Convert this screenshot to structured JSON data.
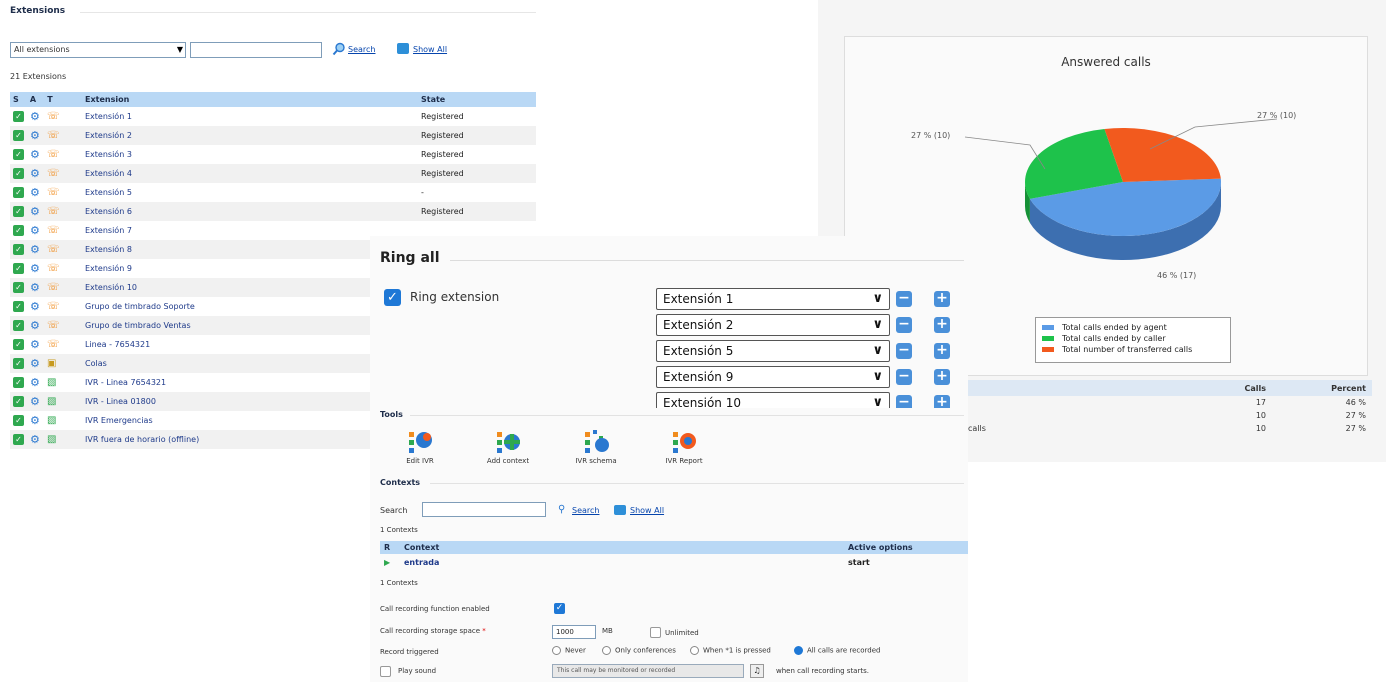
{
  "extensions": {
    "section_title": "Extensions",
    "filter_value": "All extensions",
    "search_label": "Search",
    "show_all_label": "Show All",
    "count_text": "21 Extensions",
    "headers": {
      "s": "S",
      "a": "A",
      "t": "T",
      "extension": "Extension",
      "state": "State"
    },
    "rows": [
      {
        "name": "Extensión 1",
        "state": "Registered",
        "type": "phone"
      },
      {
        "name": "Extensión 2",
        "state": "Registered",
        "type": "phone"
      },
      {
        "name": "Extensión 3",
        "state": "Registered",
        "type": "phone"
      },
      {
        "name": "Extensión 4",
        "state": "Registered",
        "type": "phone"
      },
      {
        "name": "Extensión 5",
        "state": "-",
        "type": "phone"
      },
      {
        "name": "Extensión 6",
        "state": "Registered",
        "type": "phone"
      },
      {
        "name": "Extensión 7",
        "state": "",
        "type": "phone"
      },
      {
        "name": "Extensión 8",
        "state": "",
        "type": "phone"
      },
      {
        "name": "Extensión 9",
        "state": "",
        "type": "phone"
      },
      {
        "name": "Extensión 10",
        "state": "",
        "type": "phone"
      },
      {
        "name": "Grupo de timbrado Soporte",
        "state": "",
        "type": "phone"
      },
      {
        "name": "Grupo de timbrado Ventas",
        "state": "",
        "type": "phone"
      },
      {
        "name": "Linea - 7654321",
        "state": "",
        "type": "phone"
      },
      {
        "name": "Colas",
        "state": "",
        "type": "queue"
      },
      {
        "name": "IVR - Linea 7654321",
        "state": "",
        "type": "ivr"
      },
      {
        "name": "IVR - Linea 01800",
        "state": "",
        "type": "ivr"
      },
      {
        "name": "IVR Emergencias",
        "state": "",
        "type": "ivr"
      },
      {
        "name": "IVR fuera de horario (offline)",
        "state": "",
        "type": "ivr"
      }
    ]
  },
  "pie": {
    "title": "Answered calls",
    "labels": {
      "left": "27 % (10)",
      "right": "27 % (10)",
      "bottom": "46 % (17)"
    },
    "legend": [
      {
        "label": "Total calls ended by agent",
        "color": "#5b9be6"
      },
      {
        "label": "Total calls ended by caller",
        "color": "#1ec24b"
      },
      {
        "label": "Total number of transferred calls",
        "color": "#f25a1e"
      }
    ],
    "table": {
      "headers": {
        "calls": "Calls",
        "percent": "Percent"
      },
      "rows": [
        {
          "label": "",
          "calls": "17",
          "percent": "46 %"
        },
        {
          "label": "",
          "calls": "10",
          "percent": "27 %"
        },
        {
          "label": "calls",
          "calls": "10",
          "percent": "27 %"
        }
      ]
    }
  },
  "chart_data": {
    "type": "pie",
    "title": "Answered calls",
    "categories": [
      "Total calls ended by agent",
      "Total calls ended by caller",
      "Total number of transferred calls"
    ],
    "values": [
      17,
      10,
      10
    ],
    "percent": [
      46,
      27,
      27
    ],
    "colors": [
      "#5b9be6",
      "#1ec24b",
      "#f25a1e"
    ]
  },
  "ring": {
    "title": "Ring all",
    "checkbox_label": "Ring extension",
    "checked": true,
    "selects": [
      "Extensión 1",
      "Extensión 2",
      "Extensión 5",
      "Extensión 9",
      "Extensión 10"
    ]
  },
  "tools": {
    "section_title": "Tools",
    "items": [
      {
        "label": "Edit IVR"
      },
      {
        "label": "Add context"
      },
      {
        "label": "IVR schema"
      },
      {
        "label": "IVR Report"
      }
    ],
    "contexts_title": "Contexts",
    "search_label": "Search",
    "search_link": "Search",
    "show_all": "Show All",
    "count_top": "1 Contexts",
    "count_bottom": "1 Contexts",
    "headers": {
      "r": "R",
      "context": "Context",
      "active": "Active options"
    },
    "row": {
      "context": "entrada",
      "active": "start"
    },
    "recording": {
      "enabled_label": "Call recording function enabled",
      "space_label": "Call recording storage space",
      "required_mark": "*",
      "space_value": "1000",
      "space_unit": "MB",
      "unlimited_label": "Unlimited",
      "triggered_label": "Record triggered",
      "options": [
        "Never",
        "Only conferences",
        "When *1 is pressed",
        "All calls are recorded"
      ],
      "selected_option": 3,
      "play_label": "Play sound",
      "play_message": "This call may be monitored or recorded",
      "play_after": "when call recording starts."
    }
  }
}
